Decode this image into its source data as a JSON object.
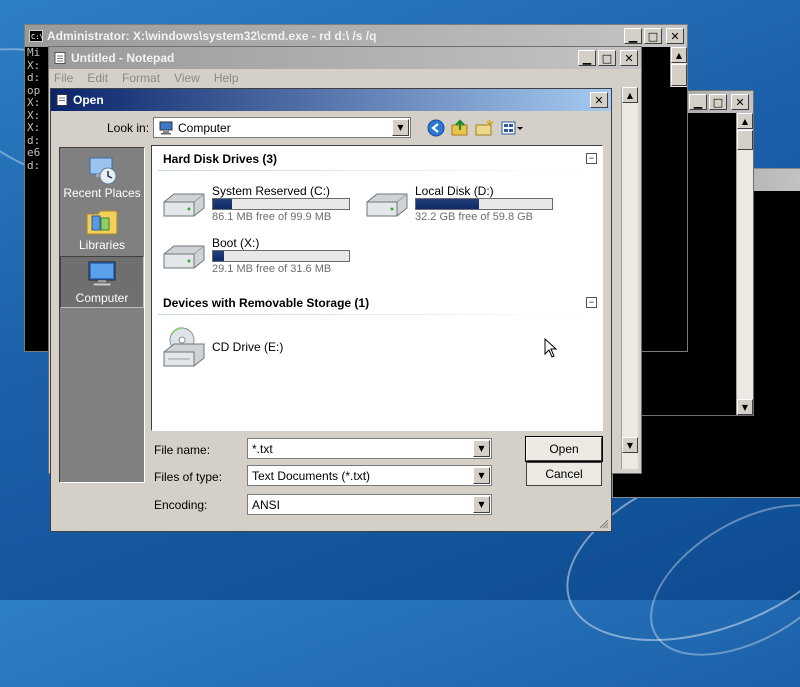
{
  "colors": {
    "desktop": "#1a5fa8",
    "titlebar_active": "#0a246a",
    "titlebar_inactive": "#9a9a9a",
    "window_face": "#d4d0c8",
    "usage_bar": "#0f2a66"
  },
  "cmd_back": {
    "title": "Administrator: X:\\windows\\system32\\cmd.exe - rd  d:\\ /s /q",
    "console_lines": [
      "Mi",
      "",
      "X:",
      "d:",
      "op",
      "",
      "X:",
      "",
      "X:",
      "",
      "X:",
      "d:",
      "e6",
      "d:"
    ]
  },
  "notepad": {
    "title": "Untitled - Notepad",
    "menu": [
      "File",
      "Edit",
      "Format",
      "View",
      "Help"
    ]
  },
  "open_dialog": {
    "title": "Open",
    "look_in_label": "Look in:",
    "look_in_value": "Computer",
    "toolbar_icons": [
      "back-icon",
      "up-folder-icon",
      "new-folder-icon",
      "view-menu-icon"
    ],
    "places": [
      {
        "label": "Recent Places",
        "icon": "recent-places-icon"
      },
      {
        "label": "Libraries",
        "icon": "libraries-icon"
      },
      {
        "label": "Computer",
        "icon": "computer-icon"
      }
    ],
    "groups": [
      {
        "title": "Hard Disk Drives (3)",
        "collapse_glyph": "−"
      },
      {
        "title": "Devices with Removable Storage (1)",
        "collapse_glyph": "−"
      }
    ],
    "drives": [
      {
        "name": "System Reserved (C:)",
        "free": "86.1 MB free of 99.9 MB",
        "used_fraction": 0.14
      },
      {
        "name": "Local Disk (D:)",
        "free": "32.2 GB free of 59.8 GB",
        "used_fraction": 0.46
      },
      {
        "name": "Boot (X:)",
        "free": "29.1 MB free of 31.6 MB",
        "used_fraction": 0.08
      }
    ],
    "removable": [
      {
        "name": "CD Drive (E:)",
        "icon": "cd-drive-icon"
      }
    ],
    "file_name_label": "File name:",
    "file_name_value": "*.txt",
    "file_type_label": "Files of type:",
    "file_type_value": "Text Documents (*.txt)",
    "encoding_label": "Encoding:",
    "encoding_value": "ANSI",
    "open_button": "Open",
    "cancel_button": "Cancel"
  }
}
